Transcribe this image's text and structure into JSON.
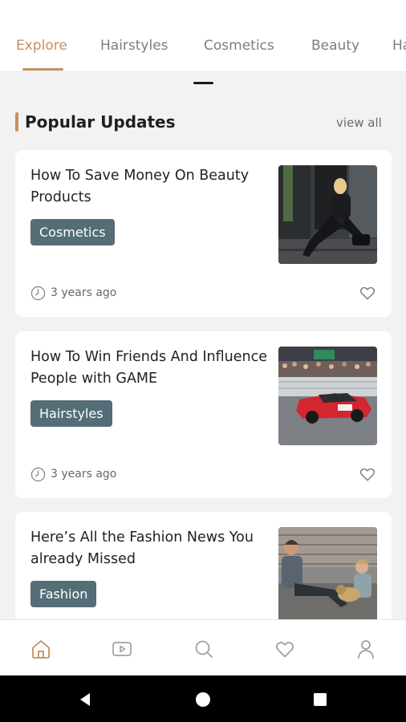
{
  "tabs": [
    {
      "label": "Explore",
      "active": true
    },
    {
      "label": "Hairstyles",
      "active": false
    },
    {
      "label": "Cosmetics",
      "active": false
    },
    {
      "label": "Beauty",
      "active": false
    },
    {
      "label": "Ha",
      "active": false
    }
  ],
  "section": {
    "title": "Popular Updates",
    "view_all": "view all"
  },
  "articles": [
    {
      "title": "How To Save Money On Beauty Products",
      "tag": "Cosmetics",
      "time": "3 years ago",
      "image": "woman-sitting-on-steps-photo"
    },
    {
      "title": "How To Win Friends And Influence People with GAME",
      "tag": "Hairstyles",
      "time": "3 years ago",
      "image": "red-race-car-drifting-photo"
    },
    {
      "title": "Here’s All the Fashion News You already Missed",
      "tag": "Fashion",
      "time": "",
      "image": "friends-with-dog-photo"
    }
  ],
  "bottom_nav": [
    {
      "icon": "home-icon",
      "active": true
    },
    {
      "icon": "video-icon",
      "active": false
    },
    {
      "icon": "search-icon",
      "active": false
    },
    {
      "icon": "heart-icon",
      "active": false
    },
    {
      "icon": "profile-icon",
      "active": false
    }
  ],
  "system_nav": [
    "back-icon",
    "home-circle-icon",
    "recents-icon"
  ],
  "colors": {
    "accent": "#c2905f",
    "tag_bg": "#546d77",
    "background": "#f2f2f2"
  }
}
